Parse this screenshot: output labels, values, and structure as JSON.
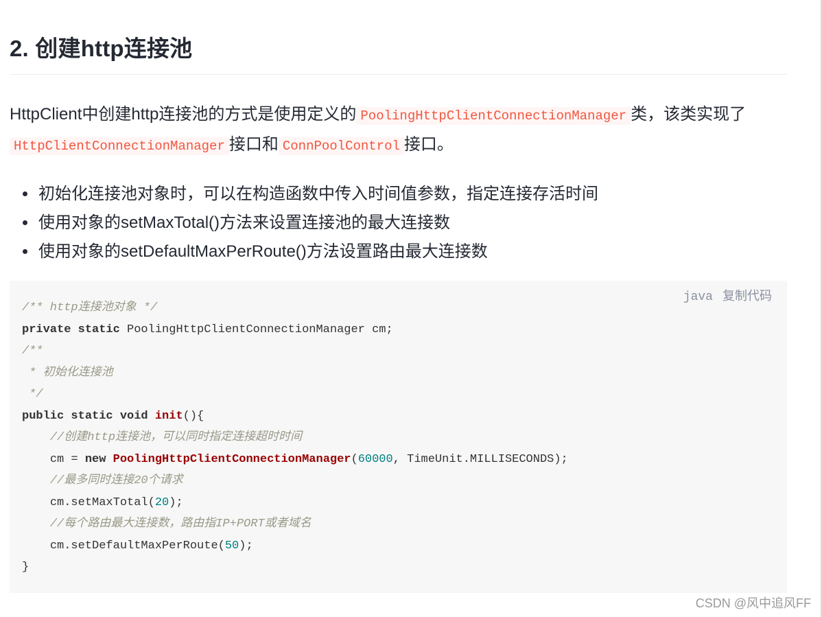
{
  "heading": "2. 创建http连接池",
  "intro": {
    "t1": "HttpClient中创建http连接池的方式是使用定义的",
    "c1": "PoolingHttpClientConnectionManager",
    "t2": "类，该类实现了",
    "c2": "HttpClientConnectionManager",
    "t3": "接口和",
    "c3": "ConnPoolControl",
    "t4": "接口。"
  },
  "bullets": [
    "初始化连接池对象时，可以在构造函数中传入时间值参数，指定连接存活时间",
    "使用对象的setMaxTotal()方法来设置连接池的最大连接数",
    "使用对象的setDefaultMaxPerRoute()方法设置路由最大连接数"
  ],
  "code_block": {
    "language": "java",
    "copy_label": "复制代码",
    "lines": {
      "l1": "/** http连接池对象 */",
      "l2_kw": "private static",
      "l2_rest": " PoolingHttpClientConnectionManager cm;",
      "l3": "/**",
      "l4": " * 初始化连接池",
      "l5": " */",
      "l6_kw": "public static void",
      "l6_fn": "init",
      "l6_rest": "(){",
      "l7": "//创建http连接池，可以同时指定连接超时时间",
      "l8_a": "cm = ",
      "l8_kw": "new",
      "l8_fn": "PoolingHttpClientConnectionManager",
      "l8_b": "(",
      "l8_num": "60000",
      "l8_c": ", TimeUnit.MILLISECONDS);",
      "l9": "//最多同时连接20个请求",
      "l10_a": "cm.setMaxTotal(",
      "l10_num": "20",
      "l10_b": ");",
      "l11": "//每个路由最大连接数，路由指IP+PORT或者域名",
      "l12_a": "cm.setDefaultMaxPerRoute(",
      "l12_num": "50",
      "l12_b": ");",
      "l13": "}"
    }
  },
  "watermark": "CSDN @风中追风FF",
  "colors": {
    "inline_code": "#f0573f",
    "code_bg": "#f7f7f7",
    "comment": "#999988",
    "function": "#990000",
    "number": "#008080"
  }
}
